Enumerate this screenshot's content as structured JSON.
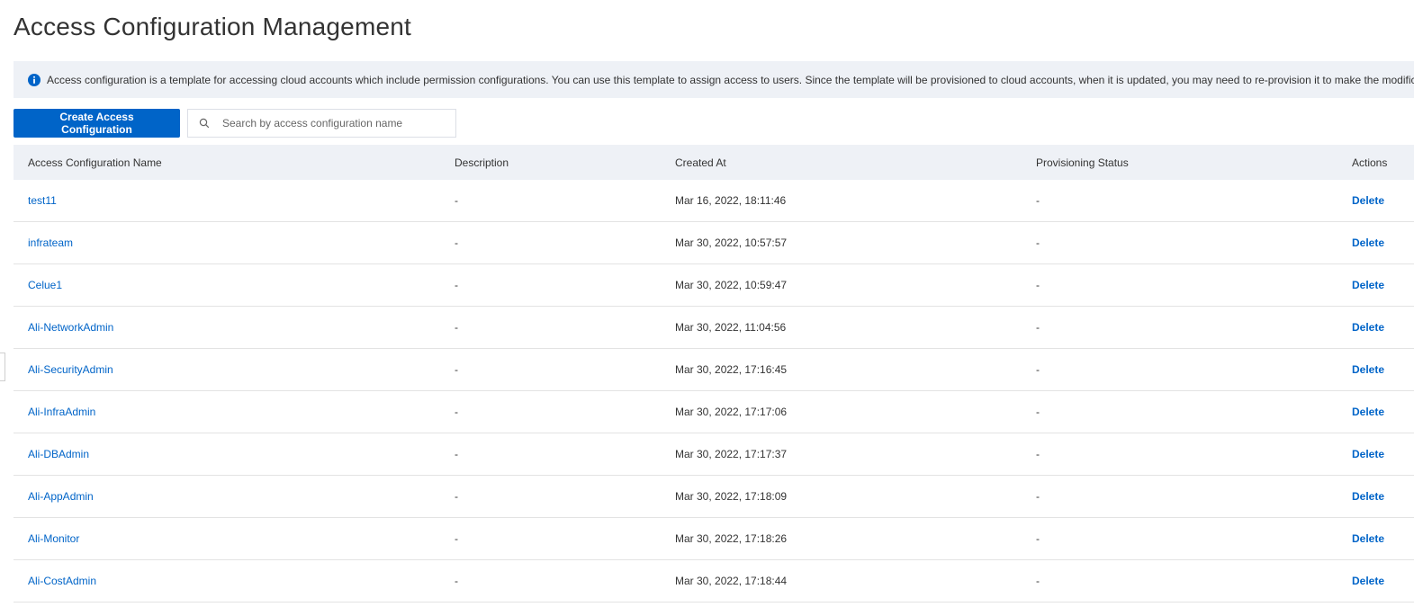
{
  "page": {
    "title": "Access Configuration Management"
  },
  "notice": {
    "icon": "info-icon",
    "text": "Access configuration is a template for accessing cloud accounts which include permission configurations. You can use this template to assign access to users. Since the template will be provisioned to cloud accounts, when it is updated, you may need to re-provision it to make the modifica"
  },
  "toolbar": {
    "create_label": "Create Access Configuration",
    "search_placeholder": "Search by access configuration name",
    "search_value": ""
  },
  "table": {
    "headers": {
      "name": "Access Configuration Name",
      "description": "Description",
      "created": "Created At",
      "status": "Provisioning Status",
      "actions": "Actions"
    },
    "rows": [
      {
        "name": "test11",
        "description": "-",
        "created": "Mar 16, 2022, 18:11:46",
        "status": "-",
        "action": "Delete"
      },
      {
        "name": "infrateam",
        "description": "-",
        "created": "Mar 30, 2022, 10:57:57",
        "status": "-",
        "action": "Delete"
      },
      {
        "name": "Celue1",
        "description": "-",
        "created": "Mar 30, 2022, 10:59:47",
        "status": "-",
        "action": "Delete"
      },
      {
        "name": "Ali-NetworkAdmin",
        "description": "-",
        "created": "Mar 30, 2022, 11:04:56",
        "status": "-",
        "action": "Delete"
      },
      {
        "name": "Ali-SecurityAdmin",
        "description": "-",
        "created": "Mar 30, 2022, 17:16:45",
        "status": "-",
        "action": "Delete"
      },
      {
        "name": "Ali-InfraAdmin",
        "description": "-",
        "created": "Mar 30, 2022, 17:17:06",
        "status": "-",
        "action": "Delete"
      },
      {
        "name": "Ali-DBAdmin",
        "description": "-",
        "created": "Mar 30, 2022, 17:17:37",
        "status": "-",
        "action": "Delete"
      },
      {
        "name": "Ali-AppAdmin",
        "description": "-",
        "created": "Mar 30, 2022, 17:18:09",
        "status": "-",
        "action": "Delete"
      },
      {
        "name": "Ali-Monitor",
        "description": "-",
        "created": "Mar 30, 2022, 17:18:26",
        "status": "-",
        "action": "Delete"
      },
      {
        "name": "Ali-CostAdmin",
        "description": "-",
        "created": "Mar 30, 2022, 17:18:44",
        "status": "-",
        "action": "Delete"
      }
    ]
  },
  "colors": {
    "primary": "#0064c8",
    "header_bg": "#eef1f6",
    "text": "#333333"
  }
}
